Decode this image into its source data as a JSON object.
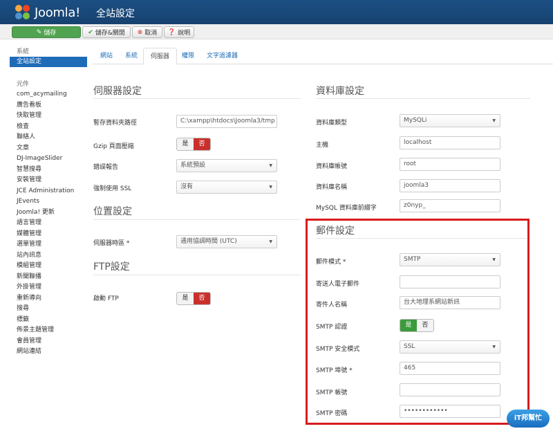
{
  "header": {
    "logo_text": "Joomla!",
    "page_title": "全站設定"
  },
  "toolbar": {
    "save_label": "儲存",
    "save_close_label": "儲存&關閉",
    "cancel_label": "取消",
    "help_label": "說明"
  },
  "sidebar": {
    "system_heading": "系統",
    "active_item": "全站設定",
    "components_heading": "元件",
    "items": [
      "com_acymailing",
      "廣告看板",
      "快取管理",
      "檢查",
      "聯絡人",
      "文章",
      "DJ-ImageSlider",
      "智慧搜尋",
      "安裝管理",
      "JCE Administration",
      "JEvents",
      "Joomla! 更新",
      "語言管理",
      "媒體管理",
      "選單管理",
      "站內訊息",
      "模組管理",
      "新聞聯播",
      "外掛管理",
      "重新導向",
      "搜尋",
      "標籤",
      "佈景主題管理",
      "會員管理",
      "網站連結"
    ]
  },
  "tabs": [
    "網站",
    "系統",
    "伺服器",
    "權限",
    "文字過濾器"
  ],
  "server": {
    "title": "伺服器設定",
    "temp_path_label": "暫存資料夾路徑",
    "temp_path_value": "C:\\xampp\\htdocs\\Joomla3/tmp",
    "gzip_label": "Gzip 頁面壓縮",
    "yes": "是",
    "no": "否",
    "error_report_label": "錯誤報告",
    "error_report_value": "系統預設",
    "force_ssl_label": "強制使用 SSL",
    "force_ssl_value": "沒有"
  },
  "location": {
    "title": "位置設定",
    "timezone_label": "伺服器時區 *",
    "timezone_value": "通用協調時間 (UTC)"
  },
  "ftp": {
    "title": "FTP設定",
    "enable_label": "啟動 FTP"
  },
  "database": {
    "title": "資料庫設定",
    "type_label": "資料庫類型",
    "type_value": "MySQLi",
    "host_label": "主機",
    "host_value": "localhost",
    "user_label": "資料庫帳號",
    "user_value": "root",
    "name_label": "資料庫名稱",
    "name_value": "joomla3",
    "prefix_label": "MySQL 資料庫前綴字",
    "prefix_value": "z0nyp_"
  },
  "mail": {
    "title": "郵件設定",
    "mailer_label": "郵件模式 *",
    "mailer_value": "SMTP",
    "from_email_label": "寄送人電子郵件",
    "from_email_value": "",
    "from_name_label": "寄件人名稱",
    "from_name_value": "台大地理系網站新訊",
    "smtp_auth_label": "SMTP 認證",
    "smtp_security_label": "SMTP 安全模式",
    "smtp_security_value": "SSL",
    "smtp_port_label": "SMTP 埠號 *",
    "smtp_port_value": "465",
    "smtp_user_label": "SMTP 帳號",
    "smtp_user_value": "",
    "smtp_pass_label": "SMTP 密碼",
    "smtp_pass_value": "••••••••••••"
  },
  "watermark": {
    "text": "iT邦幫忙"
  },
  "colors": {
    "header": "#17416f",
    "accent": "#1e6bb8",
    "save": "#51a351",
    "no_active": "#c9302c",
    "yes_active": "#3c9a3c",
    "highlight": "#d81b1b"
  }
}
